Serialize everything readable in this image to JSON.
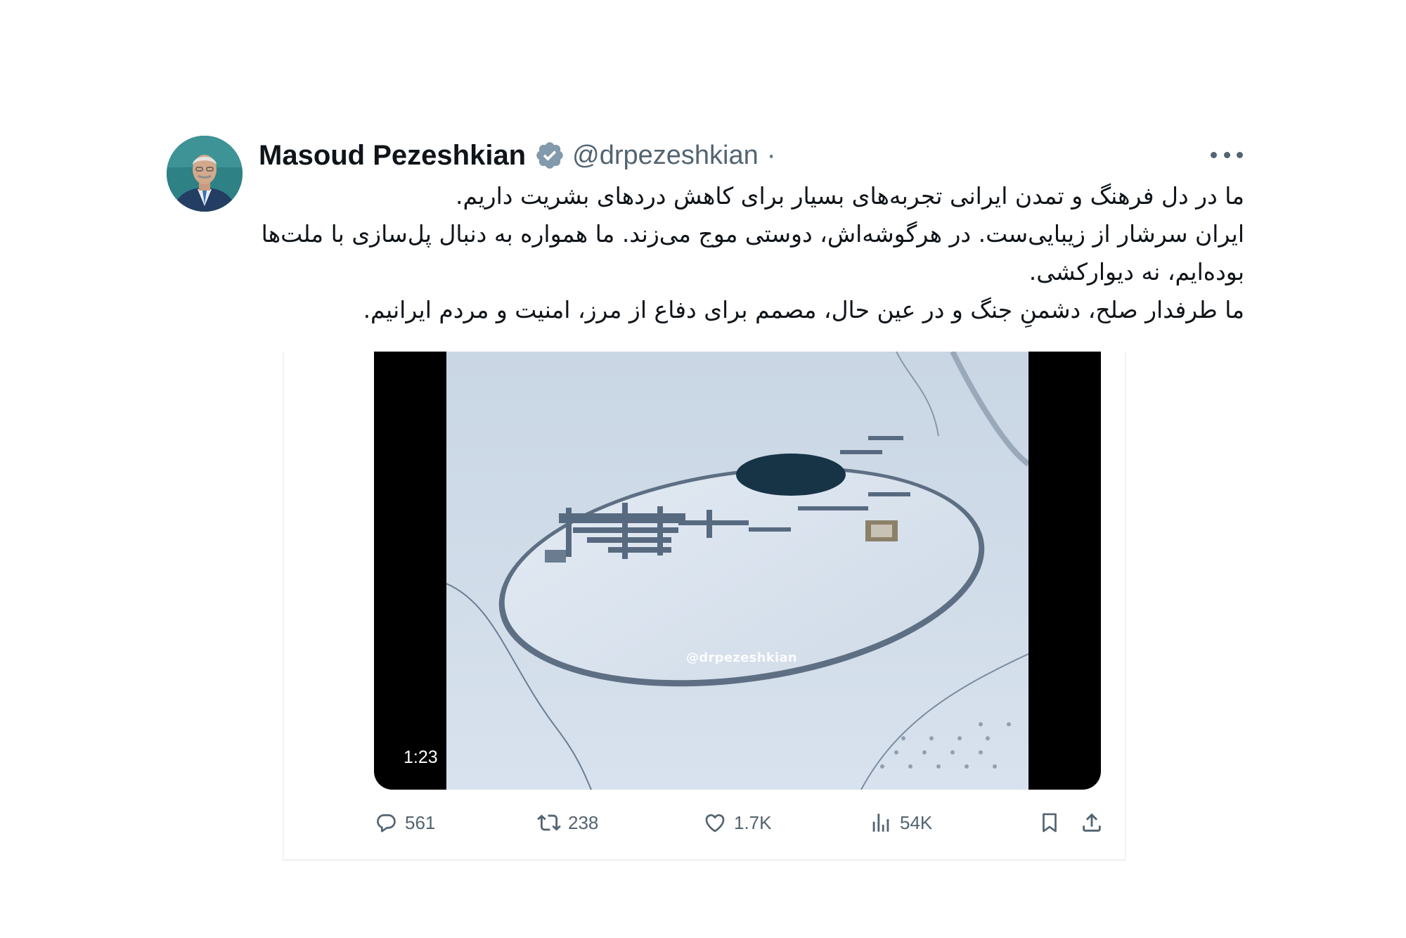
{
  "author": {
    "display_name": "Masoud Pezeshkian",
    "handle": "@drpezeshkian",
    "separator": "·",
    "verified_icon": "verified-badge-icon",
    "more_icon": "more-horizontal-icon"
  },
  "tweet": {
    "lines": [
      "ما در دل فرهنگ و تمدن ایرانی تجربه‌های بسیار برای کاهش دردهای بشریت داریم.",
      "ایران سرشار از زیبایی‌ست. در هرگوشه‌اش، دوستی موج می‌زند. ما همواره به دنبال پل‌سازی با ملت‌ها بوده‌ایم، نه دیوارکشی.",
      "ما طرفدار صلح، دشمنِ جنگ و در عین حال، مصمم برای دفاع از مرز، امنیت و مردم ایرانیم."
    ]
  },
  "media": {
    "watermark": "@drpezeshkian",
    "duration": "1:23"
  },
  "actions": {
    "replies": "561",
    "reposts": "238",
    "likes": "1.7K",
    "views": "54K",
    "icons": [
      "reply-icon",
      "repost-icon",
      "like-icon",
      "views-icon",
      "bookmark-icon",
      "share-icon"
    ]
  },
  "colors": {
    "text": "#0f1419",
    "secondary": "#536471",
    "verified": "#829aab"
  }
}
